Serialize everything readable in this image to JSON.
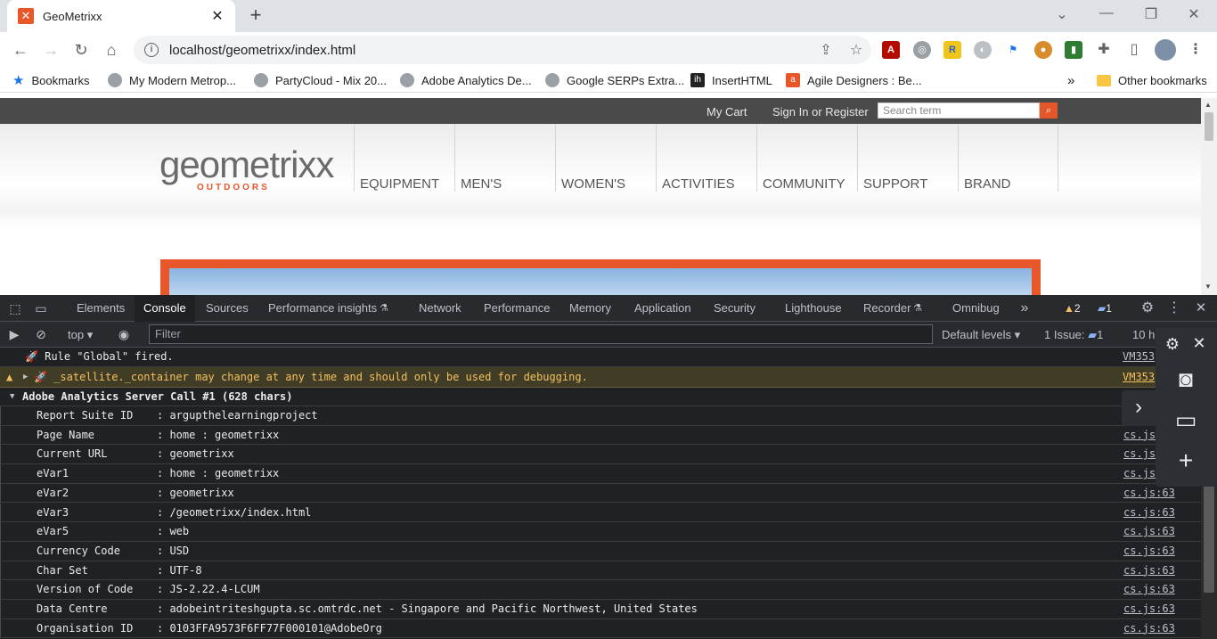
{
  "browser": {
    "tab_title": "GeoMetrixx",
    "url": "localhost/geometrixx/index.html",
    "bookmarks": [
      {
        "label": "Bookmarks"
      },
      {
        "label": "My Modern Metrop..."
      },
      {
        "label": "PartyCloud - Mix 20..."
      },
      {
        "label": "Adobe Analytics De..."
      },
      {
        "label": "Google SERPs Extra..."
      },
      {
        "label": "InsertHTML"
      },
      {
        "label": "Agile Designers : Be..."
      }
    ],
    "more_bookmarks": "»",
    "other_bookmarks": "Other bookmarks"
  },
  "site": {
    "my_cart": "My Cart",
    "sign_in": "Sign In or Register",
    "search_placeholder": "Search term",
    "logo_word": "geometrixx",
    "logo_sub": "OUTDOORS",
    "nav": [
      "EQUIPMENT",
      "MEN'S",
      "WOMEN'S",
      "ACTIVITIES",
      "COMMUNITY",
      "SUPPORT",
      "BRAND"
    ]
  },
  "devtools": {
    "tabs": [
      "Elements",
      "Console",
      "Sources",
      "Performance insights",
      "Network",
      "Performance",
      "Memory",
      "Application",
      "Security",
      "Lighthouse",
      "Recorder",
      "Omnibug"
    ],
    "active_tab": "Console",
    "more_tabs": "»",
    "warning_count": "2",
    "message_count": "1",
    "context": "top",
    "filter_placeholder": "Filter",
    "levels": "Default levels",
    "issues_label": "1 Issue:",
    "issues_count": "1",
    "hidden_label": "10 hi"
  },
  "console": {
    "line1": "🚀 Rule \"Global\" fired.",
    "line1_src": "VM353",
    "line2": "🚀 _satellite._container may change at any time and should only be used for debugging.",
    "line2_src": "VM353",
    "group_title": "Adobe Analytics Server Call #1 (628 chars)",
    "entries": [
      {
        "key": "Report Suite ID",
        "value": ": argupthelearningproject",
        "src": "cs.js"
      },
      {
        "key": "Page Name",
        "value": ": home : geometrixx",
        "src": "cs.js"
      },
      {
        "key": "Current URL",
        "value": ": geometrixx",
        "src": "cs.js"
      },
      {
        "key": "eVar1",
        "value": ": home : geometrixx",
        "src": "cs.js"
      },
      {
        "key": "eVar2",
        "value": ": geometrixx",
        "src": "cs.js:63"
      },
      {
        "key": "eVar3",
        "value": ": /geometrixx/index.html",
        "src": "cs.js:63"
      },
      {
        "key": "eVar5",
        "value": ": web",
        "src": "cs.js:63"
      },
      {
        "key": "Currency Code",
        "value": ": USD",
        "src": "cs.js:63"
      },
      {
        "key": "Char Set",
        "value": ": UTF-8",
        "src": "cs.js:63"
      },
      {
        "key": "Version of Code",
        "value": ": JS-2.22.4-LCUM",
        "src": "cs.js:63"
      },
      {
        "key": "Data Centre",
        "value": ": adobeintriteshgupta.sc.omtrdc.net - Singapore and Pacific Northwest, United States",
        "src": "cs.js:63"
      },
      {
        "key": "Organisation ID",
        "value": ": 0103FFA9573F6FF77F000101@AdobeOrg",
        "src": "cs.js:63"
      }
    ]
  }
}
